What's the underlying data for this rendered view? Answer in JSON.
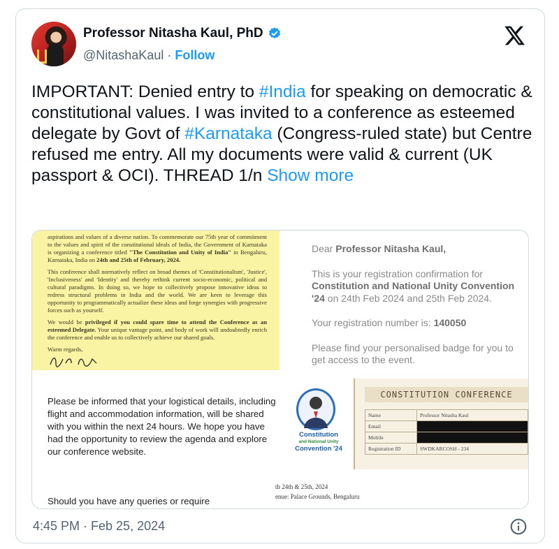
{
  "author": {
    "name": "Professor Nitasha Kaul, PhD",
    "handle": "@NitashaKaul",
    "separator": "·",
    "follow_label": "Follow",
    "icons": {
      "verified": "verified-badge-icon",
      "platform": "x-logo-icon"
    }
  },
  "tweet": {
    "text_1": "IMPORTANT: Denied entry to ",
    "hashtag_1": "#India",
    "text_2": " for speaking on democratic & constitutional values. I was invited to a conference as esteemed delegate by Govt of ",
    "hashtag_2": "#Karnataka",
    "text_3": " (Congress-ruled state) but Centre refused me entry. All my documents were valid & current (UK passport & OCI). THREAD 1/n ",
    "show_more": "Show more"
  },
  "media": {
    "letter": {
      "para1_a": "aspirations and values of a diverse nation. To commemorate our 75th year of commitment to the values and spirit of the constitutional ideals of India, the Government of Karnataka is organizing a conference titled ",
      "para1_b": "\"The Constitution and Unity of India\"",
      "para1_c": " in Bengaluru, Karnataka, India on ",
      "para1_d": "24th and 25th of February, 2024.",
      "para2": "This conference shall normatively reflect on broad themes of 'Constitutionalism', 'Justice', 'Inclusiveness' and 'Identity' and thereby rethink current socio-economic, political and cultural paradigms. In doing so, we hope to collectively propose innovative ideas to redress structural problems in India and the world. We are keen to leverage this opportunity to programmatically actualize these ideas and forge synergies with progressive forces such as yourself.",
      "para3_a": "We would be ",
      "para3_b": "privileged if you could spare time to attend the Conference as an esteemed Delegate.",
      "para3_c": " Your unique vantage point, and body of work will undoubtedly enrich the conference and enable us to collectively achieve our shared goals.",
      "closing": "Warm regards,"
    },
    "email": {
      "greeting": "Dear ",
      "recipient": "Professor Nitasha Kaul,",
      "line1_a": "This is your registration confirmation for ",
      "line1_b": "Constitution and National Unity Convention '24",
      "line1_c": " on 24th Feb 2024 and 25th Feb 2024.",
      "reg_label": "Your registration number is: ",
      "reg_number": "140050",
      "badge_note": "Please find your personalised badge for you to get access to the event."
    },
    "notice": "Please be informed that your logistical details, including flight and accommodation information, will be shared with you within the next 24 hours. We hope you have had the opportunity to review the agenda and explore our conference website.",
    "queries": "Should you have any queries or require",
    "logo": {
      "line1": "Constitution",
      "line2": "and National Unity",
      "line3": "Convention '24"
    },
    "badge": {
      "title": "CONSTITUTION CONFERENCE",
      "rows": [
        {
          "key": "Name",
          "value": "Professor Nitasha Kaul"
        },
        {
          "key": "Email",
          "value": ""
        },
        {
          "key": "Mobile",
          "value": ""
        },
        {
          "key": "Registration ID",
          "value": "SWDKARCOSH - 234"
        }
      ]
    },
    "event_dates": "th 24th & 25th, 2024",
    "event_venue": "enue: Palace Grounds, Bengaluru"
  },
  "footer": {
    "timestamp": "4:45 PM · Feb 25, 2024",
    "info_icon": "info-icon"
  }
}
